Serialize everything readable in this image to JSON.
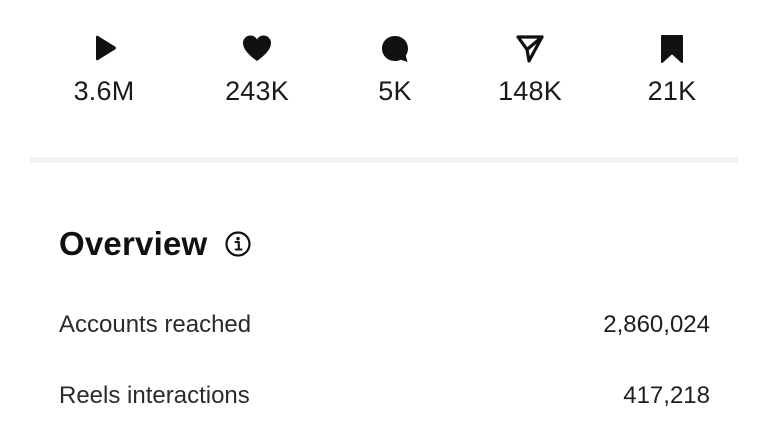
{
  "stats": [
    {
      "icon": "play-icon",
      "value": "3.6M"
    },
    {
      "icon": "heart-icon",
      "value": "243K"
    },
    {
      "icon": "comment-icon",
      "value": "5K"
    },
    {
      "icon": "share-icon",
      "value": "148K"
    },
    {
      "icon": "bookmark-icon",
      "value": "21K"
    }
  ],
  "overview": {
    "title": "Overview",
    "info_icon": "info-icon",
    "metrics": [
      {
        "label": "Accounts reached",
        "value": "2,860,024"
      },
      {
        "label": "Reels interactions",
        "value": "417,218"
      }
    ]
  },
  "colors": {
    "text": "#111111",
    "divider": "#f2f4f4",
    "background": "#ffffff"
  }
}
